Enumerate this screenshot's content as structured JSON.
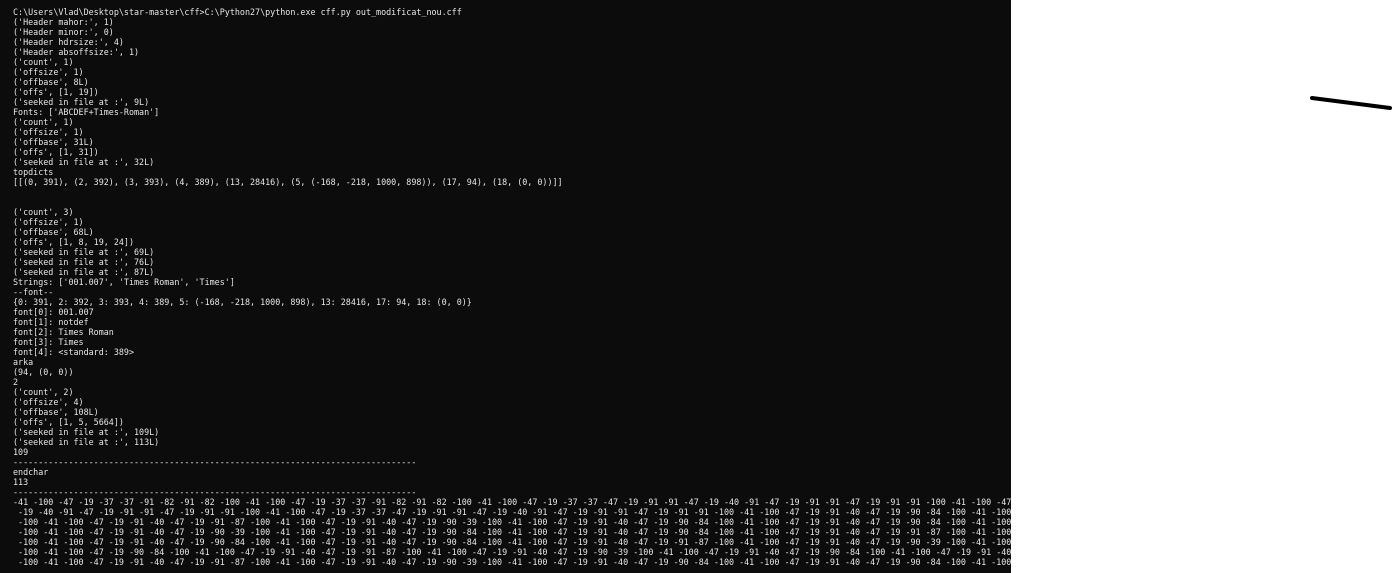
{
  "console": {
    "lines": [
      "C:\\Users\\Vlad\\Desktop\\star-master\\cff>C:\\Python27\\python.exe cff.py out_modificat_nou.cff",
      "('Header mahor:', 1)",
      "('Header minor:', 0)",
      "('Header hdrsize:', 4)",
      "('Header absoffsize:', 1)",
      "('count', 1)",
      "('offsize', 1)",
      "('offbase', 8L)",
      "('offs', [1, 19])",
      "('seeked in file at :', 9L)",
      "Fonts: ['ABCDEF+Times-Roman']",
      "('count', 1)",
      "('offsize', 1)",
      "('offbase', 31L)",
      "('offs', [1, 31])",
      "('seeked in file at :', 32L)",
      "topdicts",
      "[[(0, 391), (2, 392), (3, 393), (4, 389), (13, 28416), (5, (-168, -218, 1000, 898)), (17, 94), (18, (0, 0))]]",
      "",
      "",
      "('count', 3)",
      "('offsize', 1)",
      "('offbase', 68L)",
      "('offs', [1, 8, 19, 24])",
      "('seeked in file at :', 69L)",
      "('seeked in file at :', 76L)",
      "('seeked in file at :', 87L)",
      "Strings: ['001.007', 'Times Roman', 'Times']",
      "--font--",
      "{0: 391, 2: 392, 3: 393, 4: 389, 5: (-168, -218, 1000, 898), 13: 28416, 17: 94, 18: (0, 0)}",
      "font[0]: 001.007",
      "font[1]: notdef",
      "font[2]: Times Roman",
      "font[3]: Times",
      "font[4]: <standard: 389>",
      "arka",
      "(94, (0, 0))",
      "2",
      "('count', 2)",
      "('offsize', 4)",
      "('offbase', 108L)",
      "('offs', [1, 5, 5664])",
      "('seeked in file at :', 109L)",
      "('seeked in file at :', 113L)",
      "109",
      "--------------------------------------------------------------------------------",
      "endchar",
      "113",
      "--------------------------------------------------------------------------------",
      "-41 -100 -47 -19 -37 -37 -91 -82 -91 -82 -100 -41 -100 -47 -19 -37 -37 -91 -82 -91 -82 -100 -41 -100 -47 -19 -37 -37 -47 -19 -91 -91 -47 -19 -40 -91 -47 -19 -91 -91 -47 -19 -91 -91 -100 -41 -100 -47 -",
      " -19 -40 -91 -47 -19 -91 -91 -47 -19 -91 -91 -100 -41 -100 -47 -19 -37 -37 -47 -19 -91 -91 -47 -19 -40 -91 -47 -19 -91 -91 -47 -19 -91 -91 -100 -41 -100 -47 -19 -91 -40 -47 -19 -90 -84 -100 -41 -100 -",
      " -100 -41 -100 -47 -19 -91 -40 -47 -19 -91 -87 -100 -41 -100 -47 -19 -91 -40 -47 -19 -90 -39 -100 -41 -100 -47 -19 -91 -40 -47 -19 -90 -84 -100 -41 -100 -47 -19 -91 -40 -47 -19 -90 -84 -100 -41 -100 -",
      " -100 -41 -100 -47 -19 -91 -40 -47 -19 -90 -39 -100 -41 -100 -47 -19 -91 -40 -47 -19 -90 -84 -100 -41 -100 -47 -19 -91 -40 -47 -19 -90 -84 -100 -41 -100 -47 -19 -91 -40 -47 -19 -91 -87 -100 -41 -100 -",
      " -100 -41 -100 -47 -19 -91 -40 -47 -19 -90 -84 -100 -41 -100 -47 -19 -91 -40 -47 -19 -90 -84 -100 -41 -100 -47 -19 -91 -40 -47 -19 -91 -87 -100 -41 -100 -47 -19 -91 -40 -47 -19 -90 -39 -100 -41 -100 -",
      " -100 -41 -100 -47 -19 -90 -84 -100 -41 -100 -47 -19 -91 -40 -47 -19 -91 -87 -100 -41 -100 -47 -19 -91 -40 -47 -19 -90 -39 -100 -41 -100 -47 -19 -91 -40 -47 -19 -90 -84 -100 -41 -100 -47 -19 -91 -40 -",
      " -100 -41 -100 -47 -19 -91 -40 -47 -19 -91 -87 -100 -41 -100 -47 -19 -91 -40 -47 -19 -90 -39 -100 -41 -100 -47 -19 -91 -40 -47 -19 -90 -84 -100 -41 -100 -47 -19 -91 -40 -47 -19 -90 -84 -100 -41 -100 -"
    ]
  },
  "colors": {
    "console_bg": "#0c0c0c",
    "console_text": "#e6e6e6",
    "page_bg": "#ffffff",
    "pen_stroke": "#000000"
  }
}
